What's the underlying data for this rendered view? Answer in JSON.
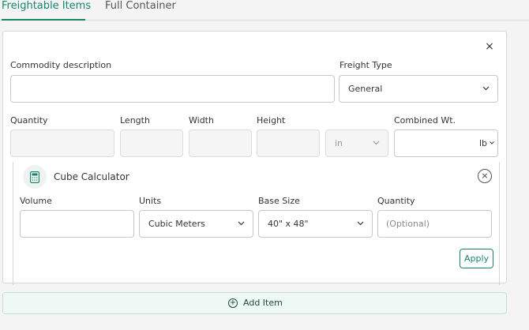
{
  "tabs": [
    {
      "label": "Freightable Items",
      "active": true
    },
    {
      "label": "Full Container",
      "active": false
    }
  ],
  "item_form": {
    "close_label": "×",
    "commodity": {
      "label": "Commodity description",
      "value": "",
      "placeholder": ""
    },
    "freight_type": {
      "label": "Freight Type",
      "value": "General"
    },
    "quantity": {
      "label": "Quantity",
      "value": ""
    },
    "length": {
      "label": "Length",
      "value": ""
    },
    "width": {
      "label": "Width",
      "value": ""
    },
    "height": {
      "label": "Height",
      "value": ""
    },
    "dim_unit": {
      "value": "in"
    },
    "combined_wt": {
      "label": "Combined Wt.",
      "value": "",
      "unit": "lb"
    }
  },
  "cube_calculator": {
    "title": "Cube Calculator",
    "close_label": "×",
    "volume": {
      "label": "Volume",
      "value": ""
    },
    "units": {
      "label": "Units",
      "value": "Cubic Meters"
    },
    "base_size": {
      "label": "Base Size",
      "value": "40\" x 48\""
    },
    "quantity": {
      "label": "Quantity",
      "placeholder": "(Optional)",
      "value": ""
    },
    "apply_label": "Apply"
  },
  "add_item": {
    "label": "Add Item",
    "icon": "plus-circle-icon"
  },
  "colors": {
    "accent": "#16866a",
    "add_bg": "#eef9f6"
  }
}
